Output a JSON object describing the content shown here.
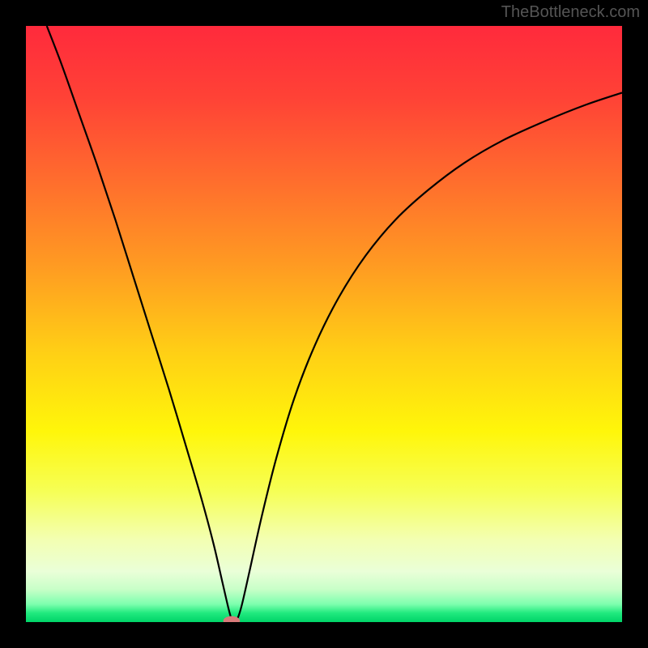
{
  "watermark": "TheBottleneck.com",
  "chart_data": {
    "type": "line",
    "title": "",
    "xlabel": "",
    "ylabel": "",
    "xlim": [
      0,
      1
    ],
    "ylim": [
      0,
      1
    ],
    "annotations": [],
    "background_gradient": {
      "stops": [
        {
          "offset": 0.0,
          "color": "#ff2a3c"
        },
        {
          "offset": 0.12,
          "color": "#ff4236"
        },
        {
          "offset": 0.25,
          "color": "#ff6a2e"
        },
        {
          "offset": 0.4,
          "color": "#ff9a22"
        },
        {
          "offset": 0.55,
          "color": "#ffd015"
        },
        {
          "offset": 0.68,
          "color": "#fff60a"
        },
        {
          "offset": 0.78,
          "color": "#f6ff55"
        },
        {
          "offset": 0.86,
          "color": "#f3ffb0"
        },
        {
          "offset": 0.915,
          "color": "#eaffd8"
        },
        {
          "offset": 0.945,
          "color": "#c8ffc8"
        },
        {
          "offset": 0.97,
          "color": "#7dffae"
        },
        {
          "offset": 0.985,
          "color": "#20e97e"
        },
        {
          "offset": 1.0,
          "color": "#00d468"
        }
      ]
    },
    "marker": {
      "x": 0.345,
      "y": 0.002,
      "color": "#d97a7a",
      "rx": 0.014,
      "ry": 0.008
    },
    "series": [
      {
        "name": "curve",
        "color": "#000000",
        "width": 2.2,
        "points": [
          {
            "x": 0.035,
            "y": 1.0
          },
          {
            "x": 0.06,
            "y": 0.935
          },
          {
            "x": 0.09,
            "y": 0.85
          },
          {
            "x": 0.12,
            "y": 0.765
          },
          {
            "x": 0.15,
            "y": 0.675
          },
          {
            "x": 0.18,
            "y": 0.58
          },
          {
            "x": 0.21,
            "y": 0.485
          },
          {
            "x": 0.24,
            "y": 0.39
          },
          {
            "x": 0.27,
            "y": 0.29
          },
          {
            "x": 0.295,
            "y": 0.205
          },
          {
            "x": 0.315,
            "y": 0.13
          },
          {
            "x": 0.33,
            "y": 0.065
          },
          {
            "x": 0.34,
            "y": 0.022
          },
          {
            "x": 0.345,
            "y": 0.005
          },
          {
            "x": 0.35,
            "y": 0.0
          },
          {
            "x": 0.355,
            "y": 0.006
          },
          {
            "x": 0.362,
            "y": 0.028
          },
          {
            "x": 0.375,
            "y": 0.085
          },
          {
            "x": 0.395,
            "y": 0.175
          },
          {
            "x": 0.42,
            "y": 0.275
          },
          {
            "x": 0.45,
            "y": 0.375
          },
          {
            "x": 0.485,
            "y": 0.465
          },
          {
            "x": 0.525,
            "y": 0.545
          },
          {
            "x": 0.57,
            "y": 0.615
          },
          {
            "x": 0.62,
            "y": 0.675
          },
          {
            "x": 0.675,
            "y": 0.725
          },
          {
            "x": 0.735,
            "y": 0.77
          },
          {
            "x": 0.8,
            "y": 0.808
          },
          {
            "x": 0.87,
            "y": 0.84
          },
          {
            "x": 0.94,
            "y": 0.868
          },
          {
            "x": 1.0,
            "y": 0.888
          }
        ]
      }
    ]
  }
}
